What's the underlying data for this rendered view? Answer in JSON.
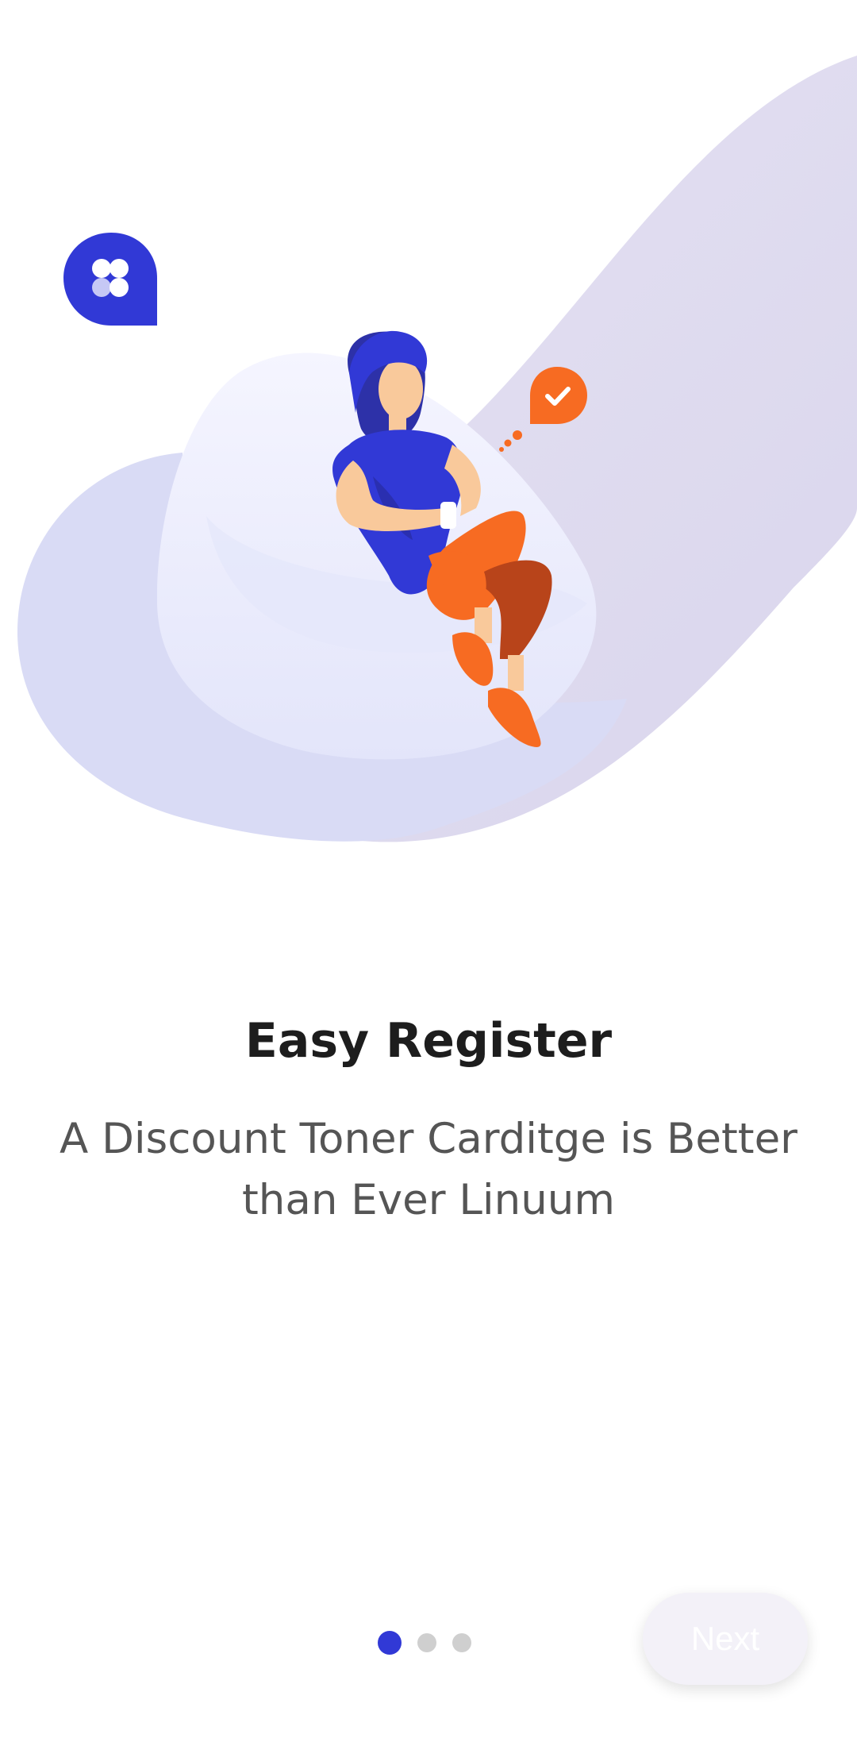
{
  "onboarding": {
    "title": "Easy Register",
    "subtitle": "A Discount Toner Carditge is Better than Ever Linuum",
    "current_page": 1,
    "total_pages": 3,
    "next_label": "Next"
  },
  "illustration": {
    "icons": [
      "app-logo-icon",
      "checkmark-bubble-icon"
    ],
    "colors": {
      "brand_blue": "#3139d6",
      "accent_orange": "#f76b22",
      "wave_lavender": "#ddd9ee",
      "blob_light": "#eef0ff",
      "skin": "#f9c99b"
    }
  },
  "pagination": {
    "active_color": "#3139d6",
    "inactive_color": "#cfcfcf"
  }
}
